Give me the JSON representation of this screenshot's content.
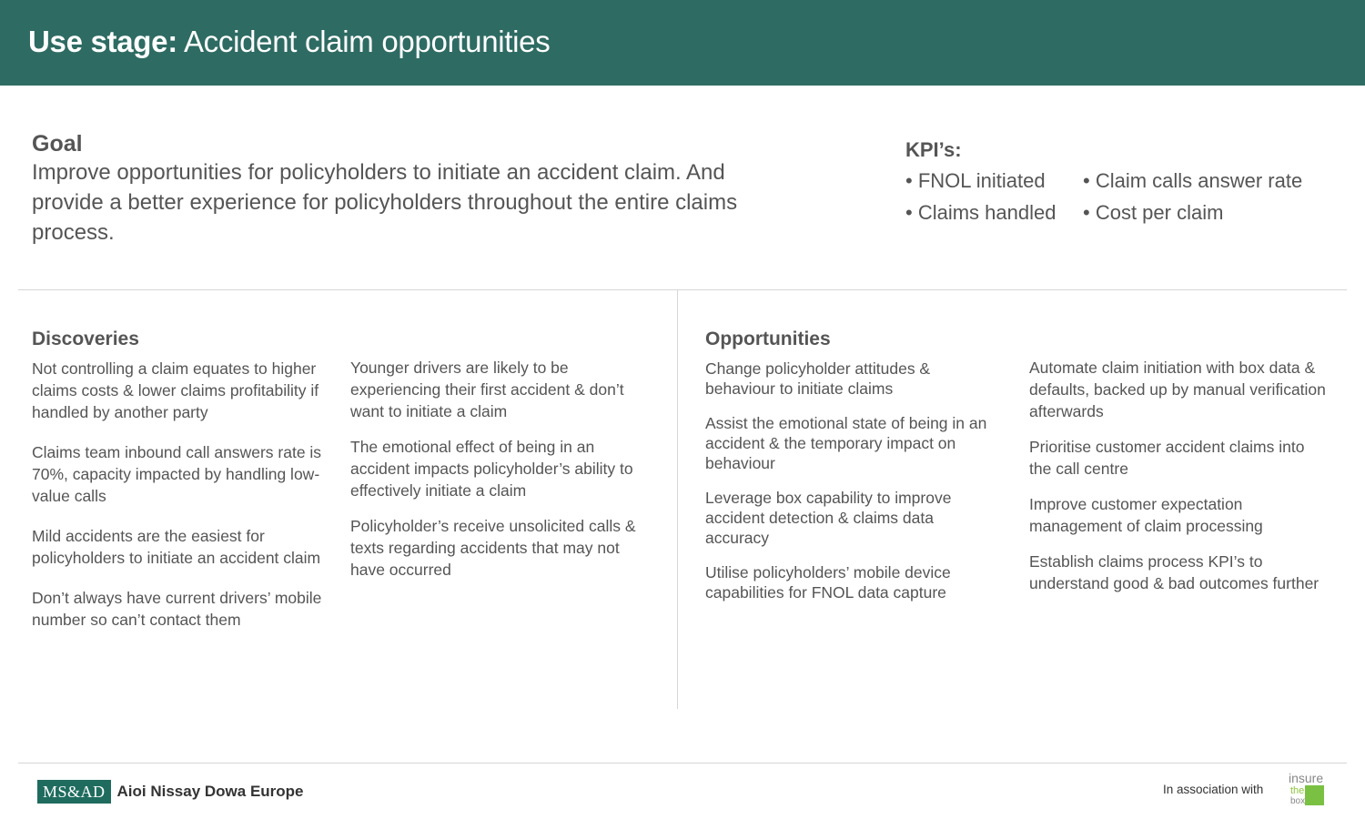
{
  "header": {
    "title_bold": "Use stage:",
    "title_rest": " Accident claim opportunities",
    "background": "#2e6b63"
  },
  "goal": {
    "title": "Goal",
    "text": "Improve opportunities for policyholders to initiate an accident claim. And provide a better experience for policyholders throughout the entire claims process."
  },
  "kpis": {
    "title": "KPI’s:",
    "items": [
      "• FNOL initiated",
      "• Claims handled",
      "• Claim calls answer rate",
      "• Cost per claim"
    ]
  },
  "discoveries": {
    "title": "Discoveries",
    "col1": [
      "Not controlling a claim equates to higher claims costs & lower claims profitability if handled by another party",
      "Claims team inbound call answers rate is 70%, capacity impacted by handling low-value calls",
      "Mild accidents are the easiest for policyholders to initiate an accident claim",
      "Don’t always have current drivers’ mobile number so can’t contact them"
    ],
    "col2": [
      "Younger drivers are likely to be experiencing their first accident & don’t want to initiate a claim",
      "The emotional effect of being in an accident impacts policyholder’s ability to effectively initiate a claim",
      "Policyholder’s receive unsolicited calls & texts regarding accidents that may not have occurred"
    ]
  },
  "opportunities": {
    "title": "Opportunities",
    "col1": [
      "Change policyholder attitudes & behaviour to initiate claims",
      "Assist the emotional state of being in an accident & the temporary impact on behaviour",
      "Leverage box capability to improve accident detection & claims data accuracy",
      "Utilise policyholders’ mobile device capabilities for FNOL data capture"
    ],
    "col2": [
      "Automate claim initiation with box data & defaults, backed up by manual verification afterwards",
      "Prioritise customer accident claims into the call centre",
      "Improve customer expectation management of claim processing",
      "Establish claims process KPI’s to understand good & bad outcomes further"
    ]
  },
  "footer": {
    "logo_mark": "MS&AD",
    "company": "Aioi Nissay Dowa Europe",
    "association": "In association with",
    "partner_logo": {
      "line1": "insure",
      "line2": "the",
      "line3": "box",
      "accent": "#7ac143"
    }
  }
}
